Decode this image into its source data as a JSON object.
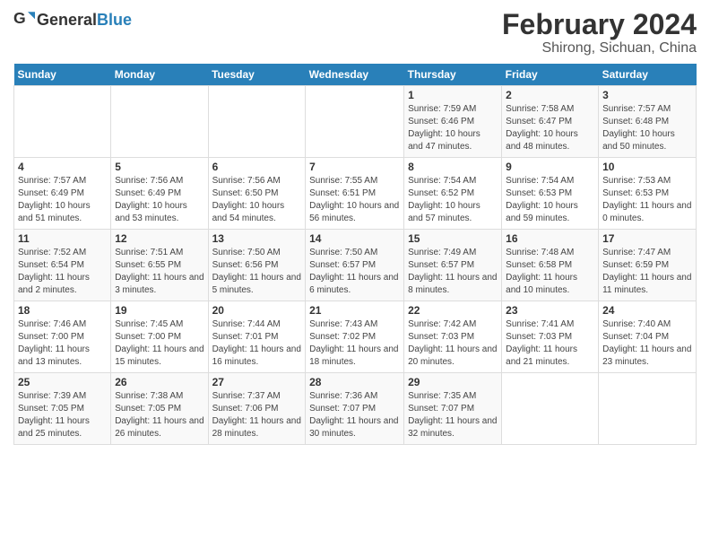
{
  "header": {
    "logo_general": "General",
    "logo_blue": "Blue",
    "title": "February 2024",
    "subtitle": "Shirong, Sichuan, China"
  },
  "days_of_week": [
    "Sunday",
    "Monday",
    "Tuesday",
    "Wednesday",
    "Thursday",
    "Friday",
    "Saturday"
  ],
  "weeks": [
    [
      {
        "day": "",
        "info": ""
      },
      {
        "day": "",
        "info": ""
      },
      {
        "day": "",
        "info": ""
      },
      {
        "day": "",
        "info": ""
      },
      {
        "day": "1",
        "info": "Sunrise: 7:59 AM\nSunset: 6:46 PM\nDaylight: 10 hours and 47 minutes."
      },
      {
        "day": "2",
        "info": "Sunrise: 7:58 AM\nSunset: 6:47 PM\nDaylight: 10 hours and 48 minutes."
      },
      {
        "day": "3",
        "info": "Sunrise: 7:57 AM\nSunset: 6:48 PM\nDaylight: 10 hours and 50 minutes."
      }
    ],
    [
      {
        "day": "4",
        "info": "Sunrise: 7:57 AM\nSunset: 6:49 PM\nDaylight: 10 hours and 51 minutes."
      },
      {
        "day": "5",
        "info": "Sunrise: 7:56 AM\nSunset: 6:49 PM\nDaylight: 10 hours and 53 minutes."
      },
      {
        "day": "6",
        "info": "Sunrise: 7:56 AM\nSunset: 6:50 PM\nDaylight: 10 hours and 54 minutes."
      },
      {
        "day": "7",
        "info": "Sunrise: 7:55 AM\nSunset: 6:51 PM\nDaylight: 10 hours and 56 minutes."
      },
      {
        "day": "8",
        "info": "Sunrise: 7:54 AM\nSunset: 6:52 PM\nDaylight: 10 hours and 57 minutes."
      },
      {
        "day": "9",
        "info": "Sunrise: 7:54 AM\nSunset: 6:53 PM\nDaylight: 10 hours and 59 minutes."
      },
      {
        "day": "10",
        "info": "Sunrise: 7:53 AM\nSunset: 6:53 PM\nDaylight: 11 hours and 0 minutes."
      }
    ],
    [
      {
        "day": "11",
        "info": "Sunrise: 7:52 AM\nSunset: 6:54 PM\nDaylight: 11 hours and 2 minutes."
      },
      {
        "day": "12",
        "info": "Sunrise: 7:51 AM\nSunset: 6:55 PM\nDaylight: 11 hours and 3 minutes."
      },
      {
        "day": "13",
        "info": "Sunrise: 7:50 AM\nSunset: 6:56 PM\nDaylight: 11 hours and 5 minutes."
      },
      {
        "day": "14",
        "info": "Sunrise: 7:50 AM\nSunset: 6:57 PM\nDaylight: 11 hours and 6 minutes."
      },
      {
        "day": "15",
        "info": "Sunrise: 7:49 AM\nSunset: 6:57 PM\nDaylight: 11 hours and 8 minutes."
      },
      {
        "day": "16",
        "info": "Sunrise: 7:48 AM\nSunset: 6:58 PM\nDaylight: 11 hours and 10 minutes."
      },
      {
        "day": "17",
        "info": "Sunrise: 7:47 AM\nSunset: 6:59 PM\nDaylight: 11 hours and 11 minutes."
      }
    ],
    [
      {
        "day": "18",
        "info": "Sunrise: 7:46 AM\nSunset: 7:00 PM\nDaylight: 11 hours and 13 minutes."
      },
      {
        "day": "19",
        "info": "Sunrise: 7:45 AM\nSunset: 7:00 PM\nDaylight: 11 hours and 15 minutes."
      },
      {
        "day": "20",
        "info": "Sunrise: 7:44 AM\nSunset: 7:01 PM\nDaylight: 11 hours and 16 minutes."
      },
      {
        "day": "21",
        "info": "Sunrise: 7:43 AM\nSunset: 7:02 PM\nDaylight: 11 hours and 18 minutes."
      },
      {
        "day": "22",
        "info": "Sunrise: 7:42 AM\nSunset: 7:03 PM\nDaylight: 11 hours and 20 minutes."
      },
      {
        "day": "23",
        "info": "Sunrise: 7:41 AM\nSunset: 7:03 PM\nDaylight: 11 hours and 21 minutes."
      },
      {
        "day": "24",
        "info": "Sunrise: 7:40 AM\nSunset: 7:04 PM\nDaylight: 11 hours and 23 minutes."
      }
    ],
    [
      {
        "day": "25",
        "info": "Sunrise: 7:39 AM\nSunset: 7:05 PM\nDaylight: 11 hours and 25 minutes."
      },
      {
        "day": "26",
        "info": "Sunrise: 7:38 AM\nSunset: 7:05 PM\nDaylight: 11 hours and 26 minutes."
      },
      {
        "day": "27",
        "info": "Sunrise: 7:37 AM\nSunset: 7:06 PM\nDaylight: 11 hours and 28 minutes."
      },
      {
        "day": "28",
        "info": "Sunrise: 7:36 AM\nSunset: 7:07 PM\nDaylight: 11 hours and 30 minutes."
      },
      {
        "day": "29",
        "info": "Sunrise: 7:35 AM\nSunset: 7:07 PM\nDaylight: 11 hours and 32 minutes."
      },
      {
        "day": "",
        "info": ""
      },
      {
        "day": "",
        "info": ""
      }
    ]
  ]
}
